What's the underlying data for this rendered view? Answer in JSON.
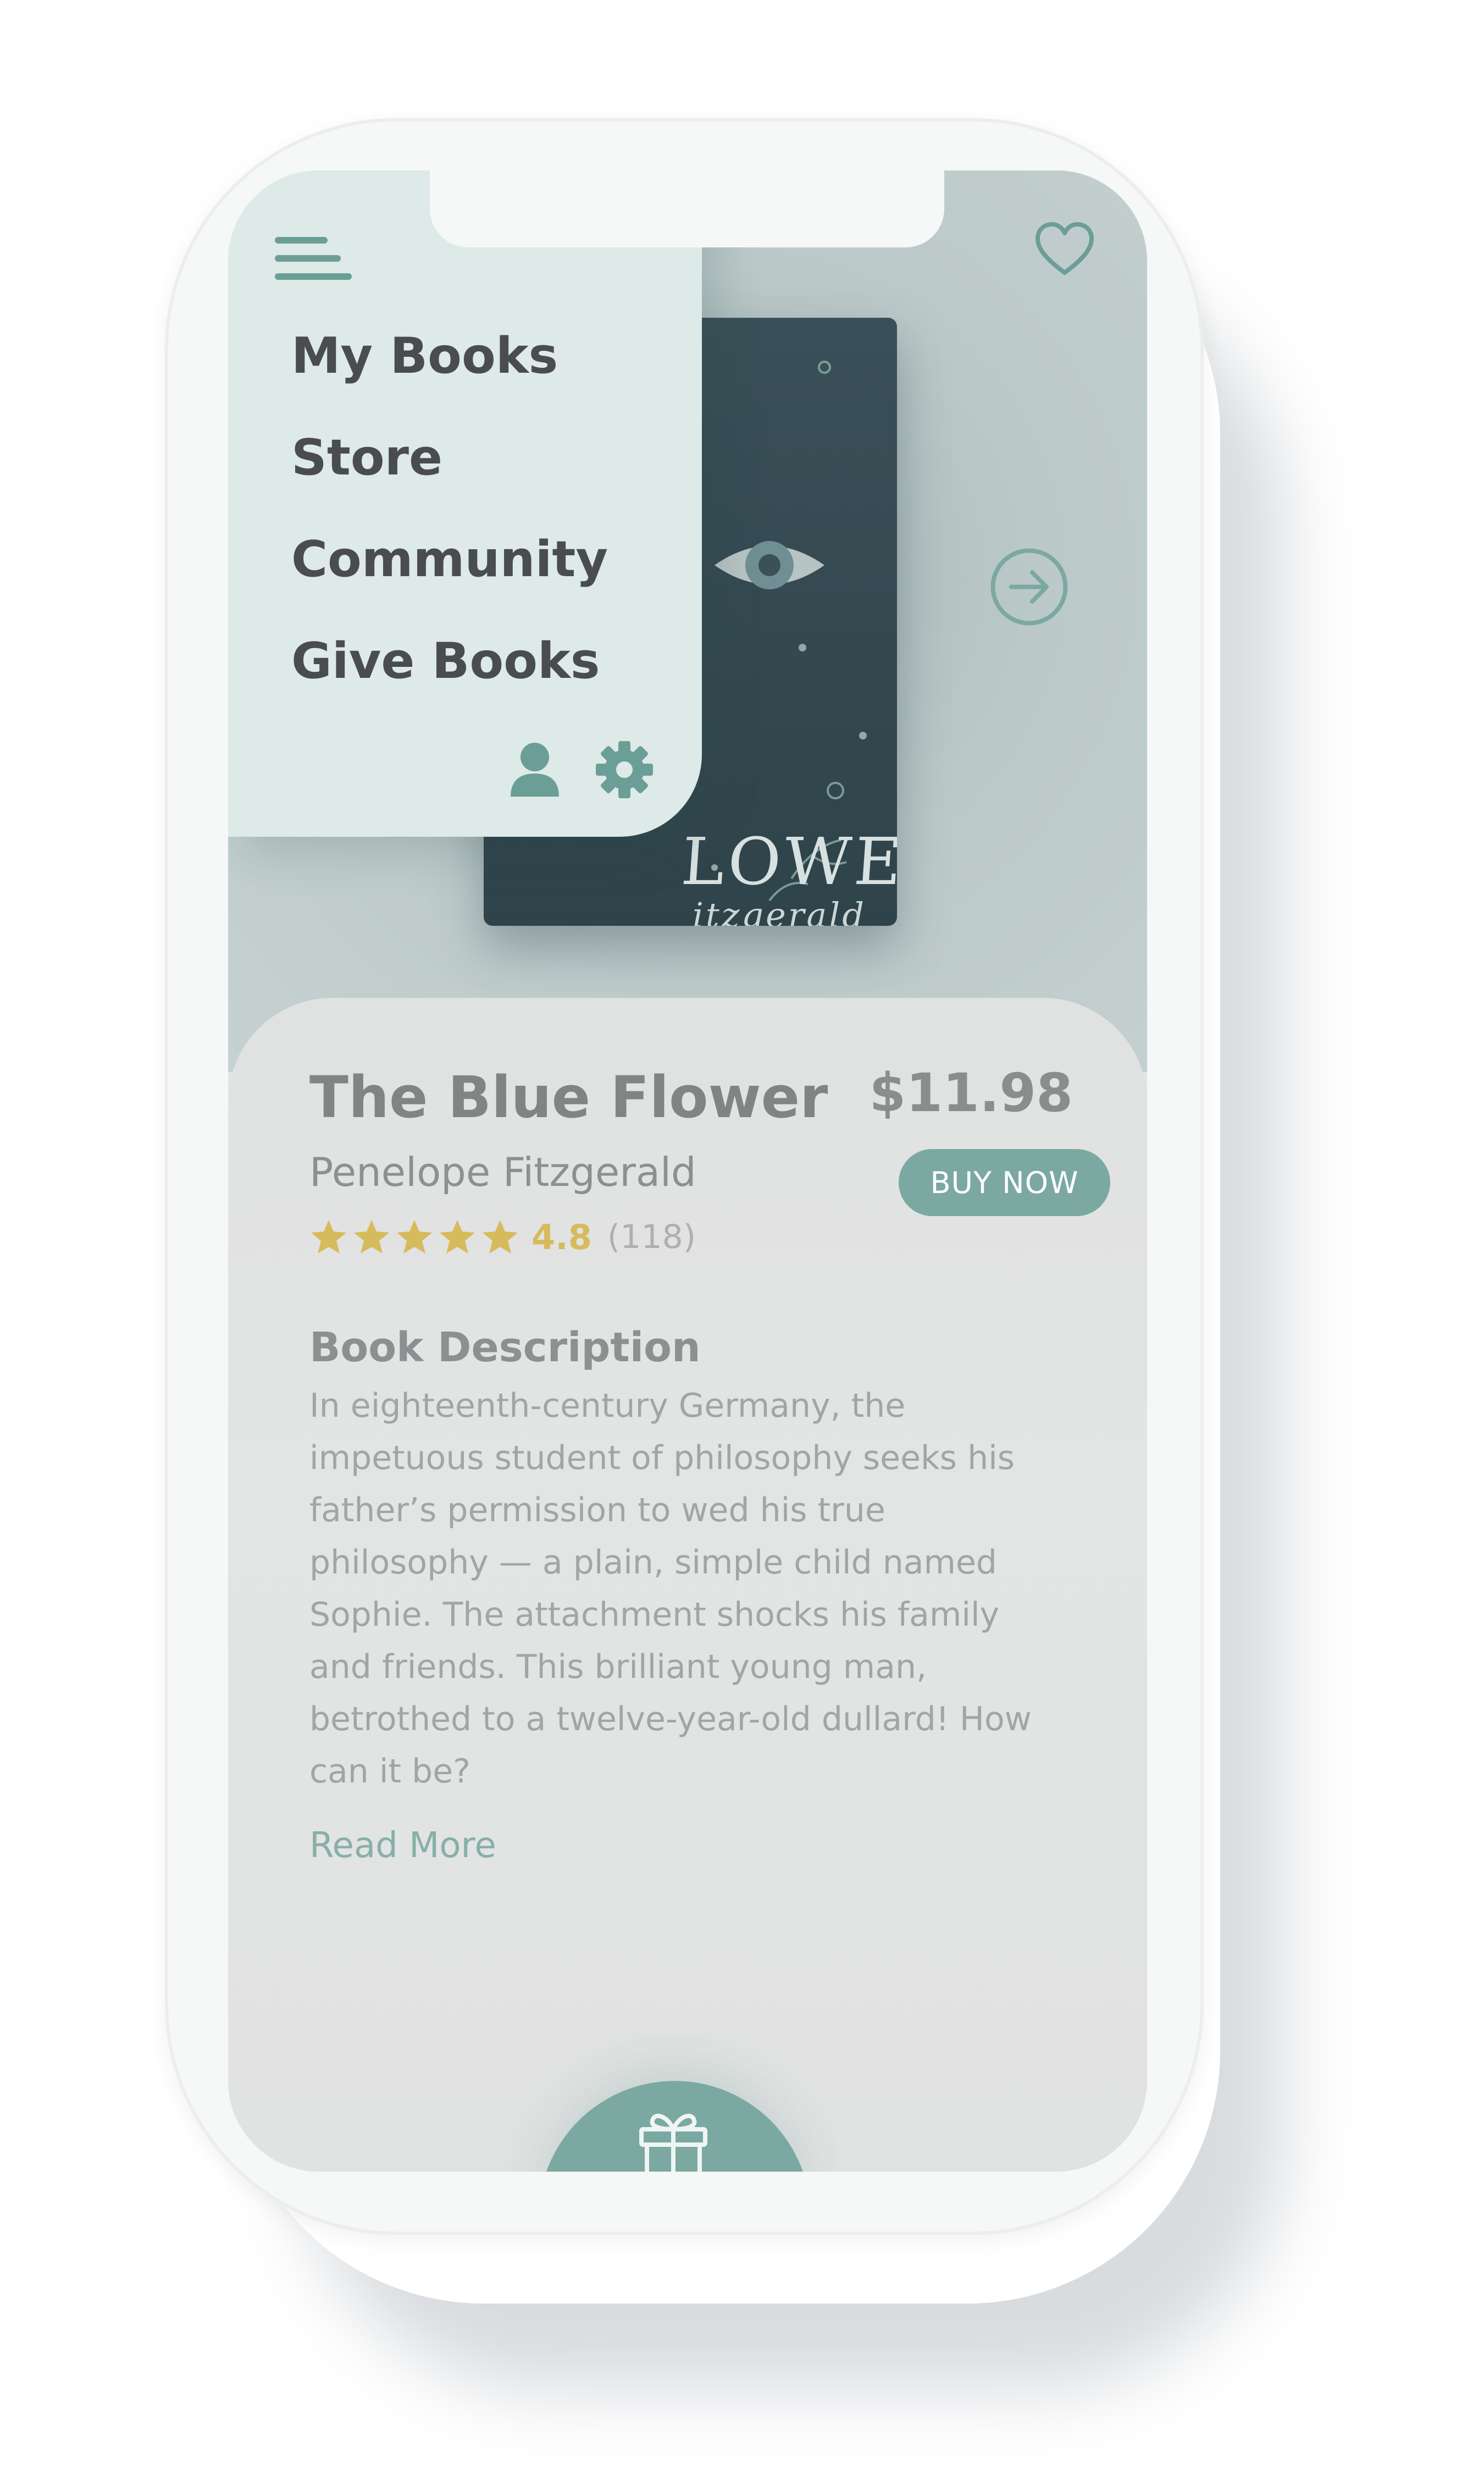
{
  "menu": {
    "items": [
      {
        "label": "My Books"
      },
      {
        "label": "Store"
      },
      {
        "label": "Community"
      },
      {
        "label": "Give Books"
      }
    ]
  },
  "cover": {
    "title_fragment": "LOWER",
    "author_fragment": "itzgerald"
  },
  "book": {
    "title": "The Blue Flower",
    "author": "Penelope Fitzgerald",
    "price": "$11.98",
    "buy_label": "BUY NOW",
    "rating_value": "4.8",
    "rating_count": "(118)",
    "stars": 5
  },
  "description": {
    "heading": "Book Description",
    "lines": [
      "In eighteenth-century Germany, the",
      "impetuous student of philosophy seeks his",
      "father’s permission to wed his true",
      "philosophy — a plain, simple child named",
      "Sophie. The attachment shocks his family",
      "and friends. This brilliant young man,",
      "betrothed to a twelve-year-old dullard! How",
      "can it be?"
    ],
    "read_more": "Read More"
  },
  "colors": {
    "accent": "#7ba9a1",
    "accent_dark": "#6b9e96",
    "star": "#d6bb5c",
    "menu_bg": "#ddeae8"
  },
  "icons": [
    "menu-icon",
    "heart-icon",
    "arrow-right-circle-icon",
    "user-icon",
    "gear-icon",
    "star-icon",
    "gift-icon"
  ]
}
